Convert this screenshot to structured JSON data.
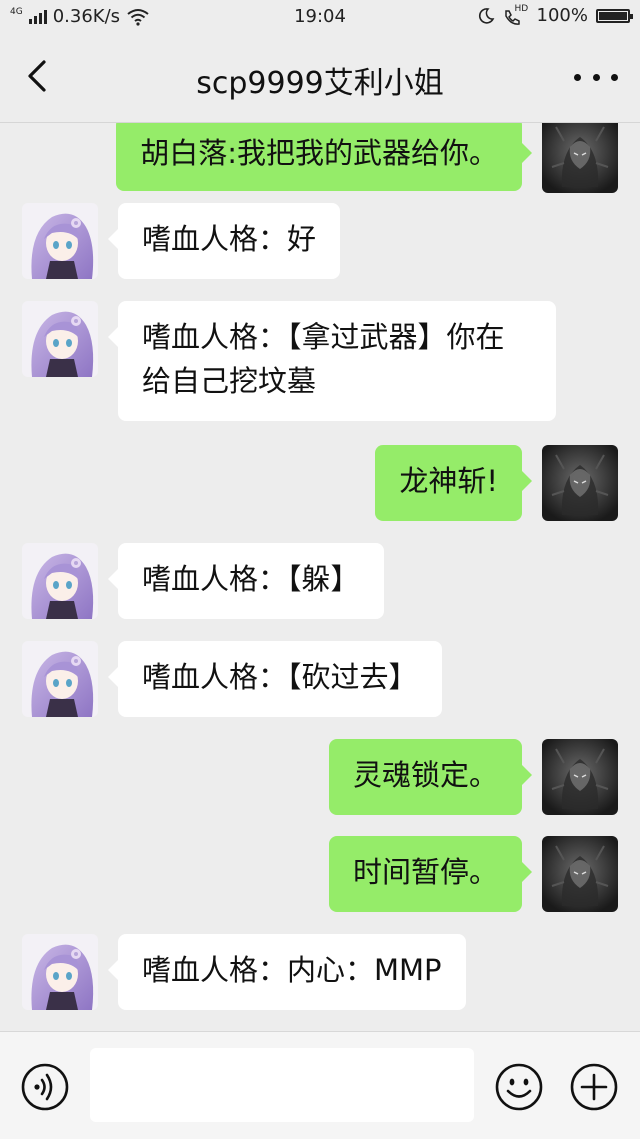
{
  "status_bar": {
    "network_type": "4G",
    "speed": "0.36K/s",
    "time": "19:04",
    "hd_label": "HD",
    "battery_percent": "100%",
    "battery_level": 1.0
  },
  "header": {
    "back_icon": "chevron-left-icon",
    "title": "scp9999艾利小姐",
    "more_icon": "more-dots-icon"
  },
  "messages": [
    {
      "side": "right",
      "text": "胡白落:我把我的武器给你。"
    },
    {
      "side": "left",
      "text": "嗜血人格：好"
    },
    {
      "side": "left",
      "text": "嗜血人格：【拿过武器】你在给自己挖坟墓"
    },
    {
      "side": "right",
      "text": "龙神斩!"
    },
    {
      "side": "left",
      "text": "嗜血人格：【躲】"
    },
    {
      "side": "left",
      "text": "嗜血人格：【砍过去】"
    },
    {
      "side": "right",
      "text": "灵魂锁定。"
    },
    {
      "side": "right",
      "text": "时间暂停。"
    },
    {
      "side": "left",
      "text": "嗜血人格：内心：MMP"
    }
  ],
  "input_bar": {
    "voice_icon": "voice-icon",
    "input_value": "",
    "emoji_icon": "emoji-icon",
    "plus_icon": "plus-circle-icon"
  },
  "colors": {
    "background": "#ededed",
    "bubble_self": "#95ec69",
    "bubble_other": "#ffffff"
  }
}
